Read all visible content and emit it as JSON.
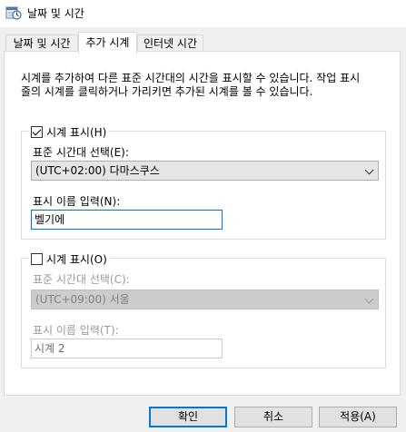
{
  "window": {
    "title": "날짜 및 시간",
    "icon": "clock-calendar-icon"
  },
  "tabs": [
    {
      "label": "날짜 및 시간"
    },
    {
      "label": "추가 시계"
    },
    {
      "label": "인터넷 시간"
    }
  ],
  "description": {
    "line1": "시계를 추가하여 다른 표준 시간대의 시간을 표시할 수 있습니다. 작업 표시",
    "line2": "줄의 시계를 클릭하거나 가리키면 추가된 시계를 볼 수 있습니다."
  },
  "clock1": {
    "show_label": "시계 표시(H)",
    "checked": true,
    "timezone_label": "표준 시간대 선택(E):",
    "timezone_value": "(UTC+02:00) 다마스쿠스",
    "name_label": "표시 이름 입력(N):",
    "name_value": "벨기에"
  },
  "clock2": {
    "show_label": "시계 표시(O)",
    "checked": false,
    "timezone_label": "표준 시간대 선택(C):",
    "timezone_value": "(UTC+09:00) 서울",
    "name_label": "표시 이름 입력(T):",
    "name_value": "시계 2"
  },
  "buttons": {
    "ok": "확인",
    "cancel": "취소",
    "apply": "적용(A)"
  },
  "colors": {
    "accent": "#0078d7",
    "panel_bg": "#ffffff",
    "window_bg": "#f0f0f0"
  }
}
